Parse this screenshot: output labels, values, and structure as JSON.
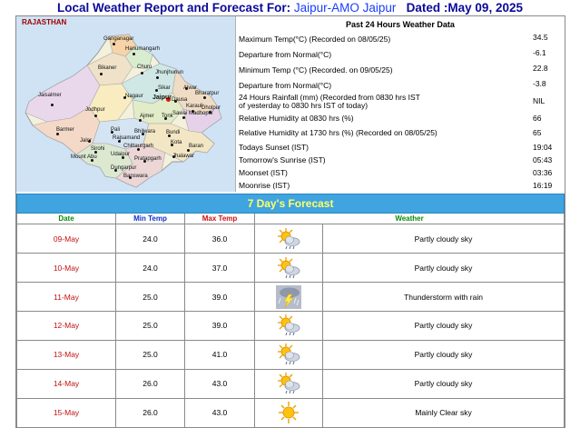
{
  "header": {
    "prefix": "Local Weather Report and Forecast For:",
    "location": "Jaipur-AMO Jaipur",
    "dated": "Dated :May 09, 2025"
  },
  "map": {
    "state": "RAJASTHAN",
    "cities": [
      "Ganganagar",
      "Hanumangarh",
      "Bikaner",
      "Churu",
      "Jhunjhunun",
      "Sikar",
      "Alwar",
      "Jaisalmer",
      "Nagaur",
      "Jaipur",
      "Dausa",
      "Bharatpur",
      "Karauli",
      "Dholpur",
      "Jodhpur",
      "Ajmer",
      "Tonk",
      "Sawai Madhopur",
      "Barmer",
      "Pali",
      "Bhilwara",
      "Bundi",
      "Jalor",
      "Rajsamand",
      "Kota",
      "Baran",
      "Sirohi",
      "Chittaurgarh",
      "Udaipur",
      "Mount Abu",
      "Jhalawar",
      "Pratapgarh",
      "Dungarpur",
      "Banswara"
    ]
  },
  "past24": {
    "title": "Past 24 Hours Weather Data",
    "rows": [
      {
        "label": "Maximum Temp(°C) (Recorded on 08/05/25)",
        "value": "34.5"
      },
      {
        "label": "Departure from Normal(°C)",
        "value": "-6.1"
      },
      {
        "label": "Minimum Temp (°C) (Recorded. on 09/05/25)",
        "value": "22.8"
      },
      {
        "label": "Departure from Normal(°C)",
        "value": "-3.8"
      },
      {
        "label": "24 Hours Rainfall (mm) (Recorded from 0830 hrs IST",
        "label2": "of yesterday to 0830 hrs IST of today)",
        "value": "NIL"
      },
      {
        "label": "Relative Humidity at 0830 hrs (%)",
        "value": "66"
      },
      {
        "label": "Relative Humidity at 1730 hrs (%) (Recorded on 08/05/25)",
        "value": "65"
      },
      {
        "label": "Todays Sunset (IST)",
        "value": "19:04"
      },
      {
        "label": "Tomorrow's Sunrise (IST)",
        "value": "05:43"
      },
      {
        "label": "Moonset (IST)",
        "value": "03:36"
      },
      {
        "label": "Moonrise (IST)",
        "value": "16:19"
      }
    ]
  },
  "forecast": {
    "title": "7 Day's Forecast",
    "headers": {
      "date": "Date",
      "min": "Min Temp",
      "max": "Max Temp",
      "weather": "Weather"
    },
    "rows": [
      {
        "date": "09-May",
        "min": "24.0",
        "max": "36.0",
        "weather": "Partly cloudy sky",
        "icon": "partly-cloudy-icon"
      },
      {
        "date": "10-May",
        "min": "24.0",
        "max": "37.0",
        "weather": "Partly cloudy sky",
        "icon": "partly-cloudy-icon"
      },
      {
        "date": "11-May",
        "min": "25.0",
        "max": "39.0",
        "weather": "Thunderstorm with rain",
        "icon": "thunderstorm-icon"
      },
      {
        "date": "12-May",
        "min": "25.0",
        "max": "39.0",
        "weather": "Partly cloudy sky",
        "icon": "partly-cloudy-icon"
      },
      {
        "date": "13-May",
        "min": "25.0",
        "max": "41.0",
        "weather": "Partly cloudy sky",
        "icon": "partly-cloudy-icon"
      },
      {
        "date": "14-May",
        "min": "26.0",
        "max": "43.0",
        "weather": "Partly cloudy sky",
        "icon": "partly-cloudy-icon"
      },
      {
        "date": "15-May",
        "min": "26.0",
        "max": "43.0",
        "weather": "Mainly Clear sky",
        "icon": "sunny-icon"
      }
    ]
  }
}
